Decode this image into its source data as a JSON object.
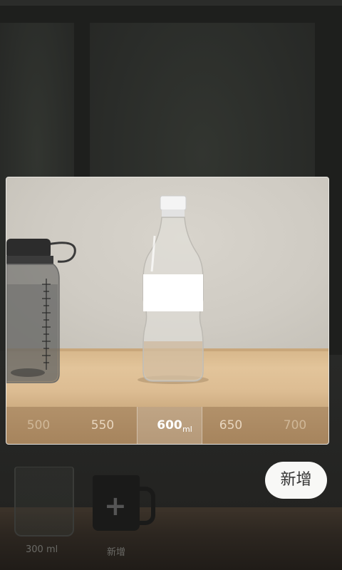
{
  "picker": {
    "values": [
      "500",
      "550",
      "600",
      "650",
      "700"
    ],
    "selected": "600",
    "unit": "ml"
  },
  "background": {
    "cup_label": "300 ml",
    "add_cup_label": "新增"
  },
  "add_button": {
    "label": "新增"
  },
  "colors": {
    "table": "#dfc196",
    "picker_bar": "#a98862",
    "dialog_border": "#e9e7e2",
    "button_bg": "#f8f8f6"
  }
}
